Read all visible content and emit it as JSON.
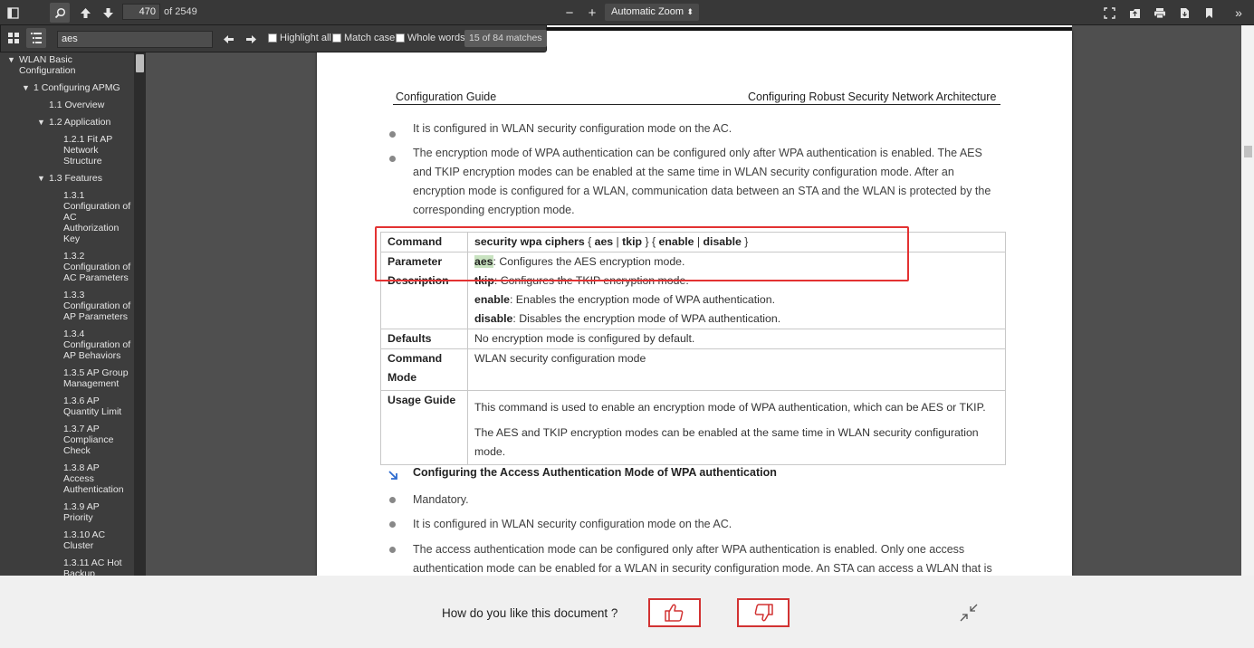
{
  "toolbar": {
    "page_number": "470",
    "page_count": "of 2549",
    "zoom_out": "−",
    "zoom_in": "+",
    "zoom_value": "Automatic Zoom",
    "icons": [
      "sidebar-toggle-icon",
      "search-icon",
      "previous-page-icon",
      "next-page-icon",
      "presentation-mode-icon",
      "open-file-icon",
      "print-icon",
      "download-icon",
      "bookmark-icon",
      "tools-icon"
    ]
  },
  "find": {
    "query": "aes",
    "highlight_all": "Highlight all",
    "match_case": "Match case",
    "whole_words": "Whole words",
    "results": "15 of 84 matches"
  },
  "sidebar": {
    "items": [
      {
        "label": "WLAN Basic\nConfiguration",
        "level": 0,
        "expanded": true
      },
      {
        "label": "1 Configuring APMG",
        "level": 1,
        "expanded": true
      },
      {
        "label": "1.1 Overview",
        "level": 2
      },
      {
        "label": "1.2 Application",
        "level": 2,
        "expanded": true
      },
      {
        "label": "1.2.1 Fit AP\nNetwork\nStructure",
        "level": 3
      },
      {
        "label": "1.3 Features",
        "level": 2,
        "expanded": true
      },
      {
        "label": "1.3.1\nConfiguration of\nAC\nAuthorization\nKey",
        "level": 3
      },
      {
        "label": "1.3.2\nConfiguration of\nAC Parameters",
        "level": 3
      },
      {
        "label": "1.3.3\nConfiguration of\nAP Parameters",
        "level": 3
      },
      {
        "label": "1.3.4\nConfiguration of\nAP Behaviors",
        "level": 3
      },
      {
        "label": "1.3.5 AP Group\nManagement",
        "level": 3
      },
      {
        "label": "1.3.6 AP\nQuantity Limit",
        "level": 3
      },
      {
        "label": "1.3.7 AP\nCompliance\nCheck",
        "level": 3
      },
      {
        "label": "1.3.8 AP\nAccess\nAuthentication",
        "level": 3
      },
      {
        "label": "1.3.9 AP\nPriority",
        "level": 3
      },
      {
        "label": "1.3.10 AC\nCluster",
        "level": 3
      },
      {
        "label": "1.3.11 AC Hot\nBackup",
        "level": 3
      }
    ]
  },
  "document": {
    "header_left": "Configuration Guide",
    "header_right": "Configuring Robust Security Network Architecture",
    "bullets_top": [
      "It is configured in WLAN security configuration mode on the AC.",
      "The encryption mode of WPA authentication can be configured only after WPA authentication is enabled. The AES and TKIP encryption modes can be enabled at the same time in WLAN security configuration mode. After an encryption mode is configured for a WLAN, communication data between an STA and the WLAN is protected by the corresponding encryption mode."
    ],
    "table": {
      "command_label": "Command",
      "command_prefix": "security wpa ciphers",
      "command_p1": " { ",
      "command_aes": "aes",
      "command_p2": " | ",
      "command_tkip": "tkip",
      "command_p3": " } { ",
      "command_enable": "enable",
      "command_p4": " | ",
      "command_disable": "disable",
      "command_p5": " }",
      "param_label": "Parameter\nDescription",
      "params": [
        {
          "name": "aes",
          "desc": ": Configures the AES encryption mode."
        },
        {
          "name": "tkip",
          "desc": ": Configures the TKIP encryption mode."
        },
        {
          "name": "enable",
          "desc": ": Enables the encryption mode of WPA authentication."
        },
        {
          "name": "disable",
          "desc": ": Disables the encryption mode of WPA authentication."
        }
      ],
      "defaults_label": "Defaults",
      "defaults_value": "No encryption mode is configured by default.",
      "mode_label": "Command\nMode",
      "mode_value": "WLAN security configuration mode",
      "usage_label": "Usage Guide",
      "usage_1": "This command is used to enable an encryption mode of WPA authentication, which can be AES or TKIP.",
      "usage_2": "The AES and TKIP encryption modes can be enabled at the same time in WLAN security configuration mode."
    },
    "section_title": "Configuring the Access Authentication Mode of WPA authentication",
    "bullets_bottom": [
      "Mandatory.",
      "It is configured in WLAN security configuration mode on the AC.",
      "The access authentication mode can be configured only after WPA authentication is enabled. Only one access authentication mode can be enabled for a WLAN in security configuration mode. An STA can access a WLAN that is"
    ]
  },
  "feedback": {
    "question": "How do you like this document ?"
  }
}
